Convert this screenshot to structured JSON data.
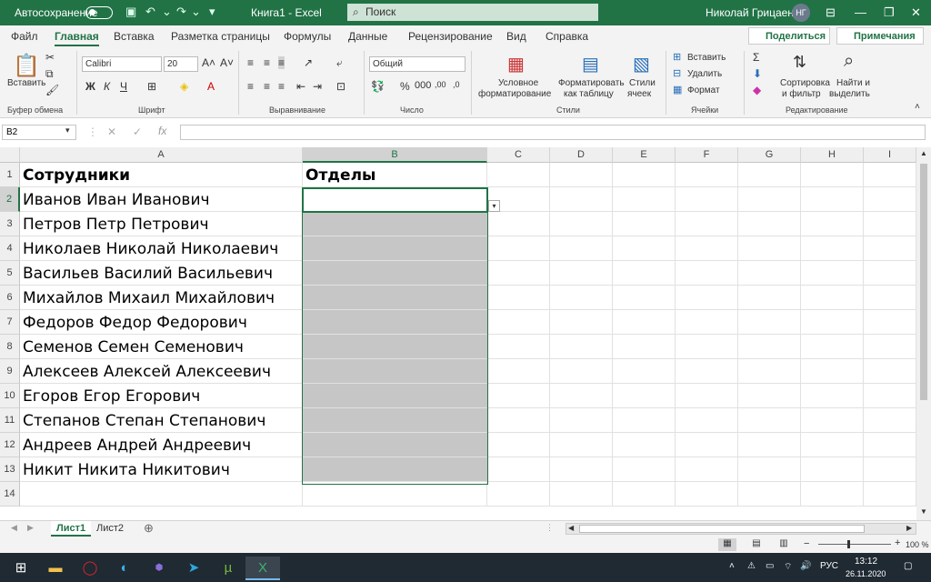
{
  "titlebar": {
    "autosave_label": "Автосохранение",
    "doc_title": "Книга1  -  Excel",
    "search_placeholder": "Поиск",
    "user_name": "Николай Грицаенко",
    "user_initials": "НГ"
  },
  "tabs": [
    "Файл",
    "Главная",
    "Вставка",
    "Разметка страницы",
    "Формулы",
    "Данные",
    "Рецензирование",
    "Вид",
    "Справка"
  ],
  "active_tab": "Главная",
  "share_label": "Поделиться",
  "notes_label": "Примечания",
  "ribbon": {
    "paste_label": "Вставить",
    "clipboard_group": "Буфер обмена",
    "font_name": "Calibri",
    "font_size": "20",
    "font_group": "Шрифт",
    "align_group": "Выравнивание",
    "number_format": "Общий",
    "number_group": "Число",
    "cond_format_l1": "Условное",
    "cond_format_l2": "форматирование",
    "format_table_l1": "Форматировать",
    "format_table_l2": "как таблицу",
    "cell_styles_l1": "Стили",
    "cell_styles_l2": "ячеек",
    "styles_group": "Стили",
    "insert_label": "Вставить",
    "delete_label": "Удалить",
    "format_label": "Формат",
    "cells_group": "Ячейки",
    "sort_l1": "Сортировка",
    "sort_l2": "и фильтр",
    "find_l1": "Найти и",
    "find_l2": "выделить",
    "editing_group": "Редактирование",
    "bold": "Ж",
    "italic": "К",
    "underline": "Ч"
  },
  "formula_bar": {
    "name_box": "B2",
    "fx": "fx",
    "value": ""
  },
  "columns": [
    "A",
    "B",
    "C",
    "D",
    "E",
    "F",
    "G",
    "H",
    "I"
  ],
  "rows": [
    "1",
    "2",
    "3",
    "4",
    "5",
    "6",
    "7",
    "8",
    "9",
    "10",
    "11",
    "12",
    "13",
    "14"
  ],
  "cells": {
    "A1": "Сотрудники",
    "B1": "Отделы",
    "A2": "Иванов Иван Иванович",
    "A3": "Петров Петр Петрович",
    "A4": "Николаев Николай Николаевич",
    "A5": "Васильев Василий Васильевич",
    "A6": "Михайлов Михаил Михайлович",
    "A7": "Федоров Федор Федорович",
    "A8": "Семенов Семен Семенович",
    "A9": "Алексеев Алексей Алексеевич",
    "A10": "Егоров Егор Егорович",
    "A11": "Степанов Степан Степанович",
    "A12": "Андреев Андрей Андреевич",
    "A13": "Никит Никита Никитович"
  },
  "sheets": [
    "Лист1",
    "Лист2"
  ],
  "active_sheet": "Лист1",
  "status": {
    "zoom": "100 %"
  },
  "taskbar": {
    "lang": "РУС",
    "time": "13:12",
    "date": "26.11.2020"
  },
  "colors": {
    "excel_green": "#217346",
    "selection_gray": "#c6c6c6"
  }
}
